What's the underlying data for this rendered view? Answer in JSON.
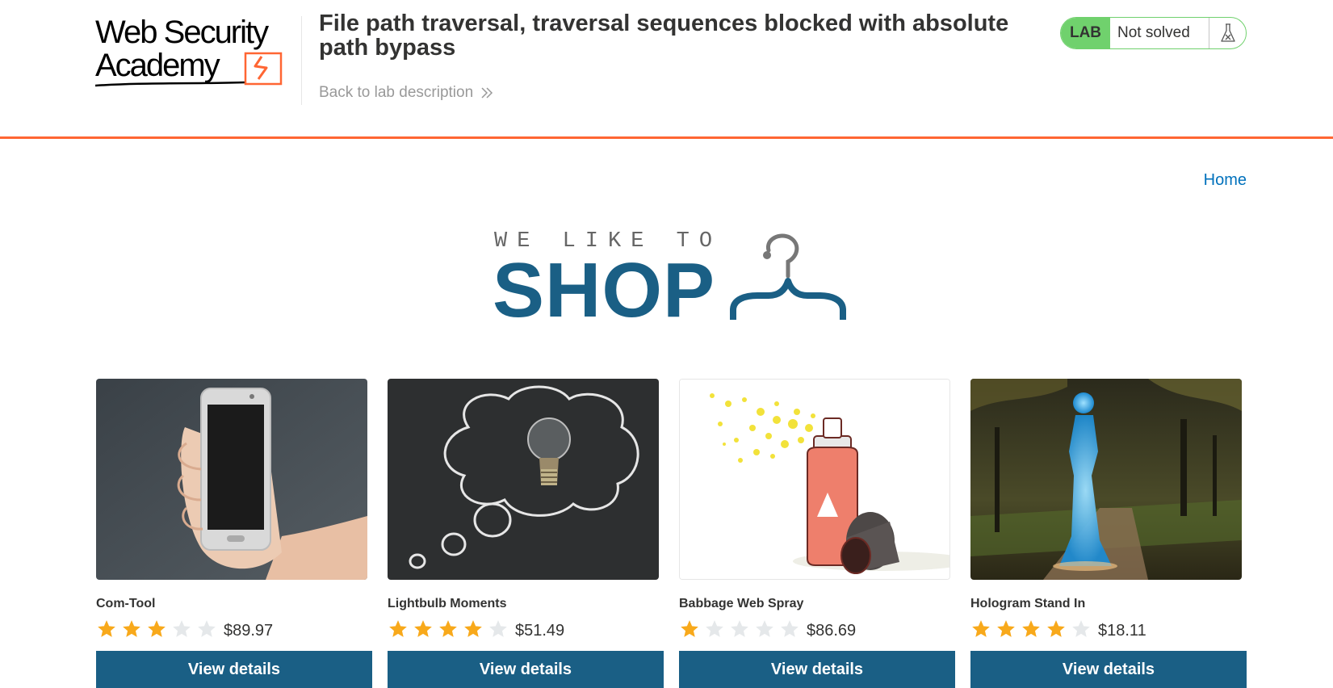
{
  "lab_header": {
    "logo_line1": "Web Security",
    "logo_line2": "Academy",
    "title": "File path traversal, traversal sequences blocked with absolute path bypass",
    "back_link": "Back to lab description",
    "status_badge": "LAB",
    "status_text": "Not solved",
    "flask_icon": "flask-icon"
  },
  "nav": {
    "home": "Home"
  },
  "banner": {
    "top_text": "WE LIKE TO",
    "main_text": "SHOP",
    "icon": "hanger-icon"
  },
  "products": [
    {
      "name": "Com-Tool",
      "rating": 3,
      "max_rating": 5,
      "price": "$89.97",
      "button": "View details"
    },
    {
      "name": "Lightbulb Moments",
      "rating": 4,
      "max_rating": 5,
      "price": "$51.49",
      "button": "View details"
    },
    {
      "name": "Babbage Web Spray",
      "rating": 1,
      "max_rating": 5,
      "price": "$86.69",
      "button": "View details"
    },
    {
      "name": "Hologram Stand In",
      "rating": 4,
      "max_rating": 5,
      "price": "$18.11",
      "button": "View details"
    }
  ],
  "colors": {
    "accent": "#ff6633",
    "brand": "#1a5f85",
    "lab_green": "#70d16d",
    "link": "#0071bc",
    "star_on": "#f8a91b",
    "star_off": "#e5e8ea"
  }
}
